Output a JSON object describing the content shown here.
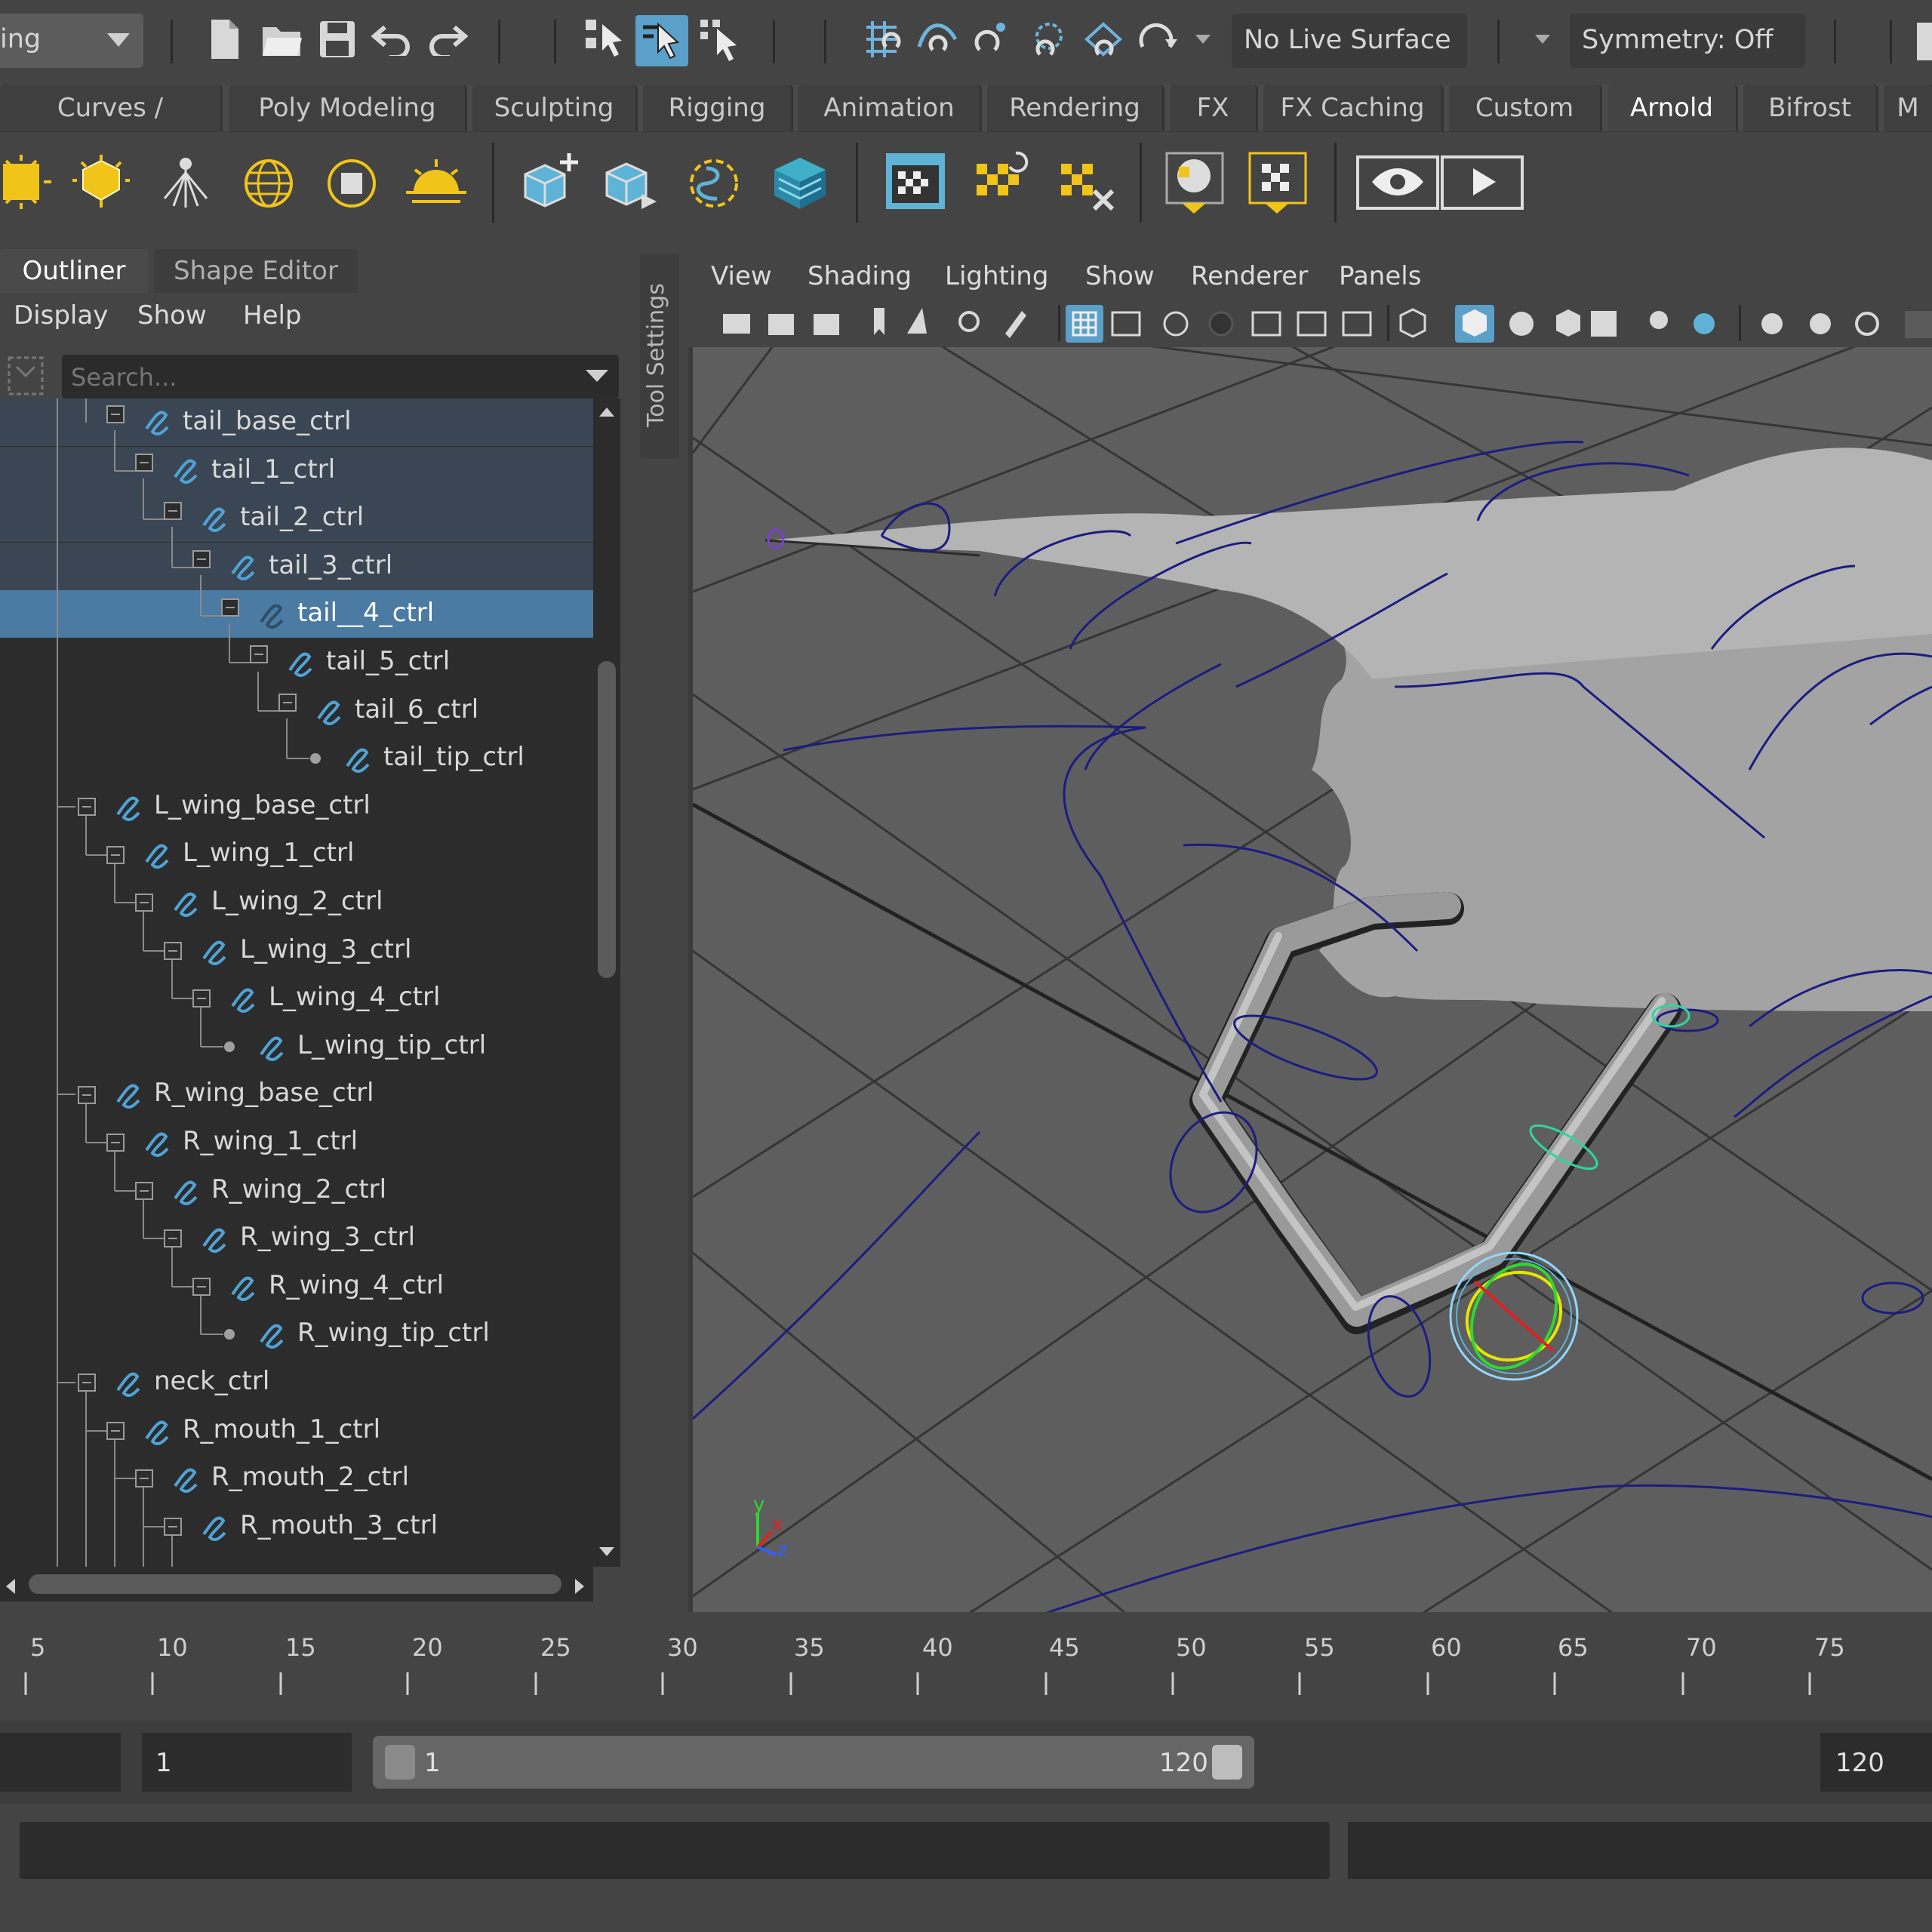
{
  "toolbar": {
    "menu_set": "ing",
    "live_surface": "No Live Surface",
    "symmetry": "Symmetry: Off"
  },
  "shelf_tabs": [
    "Curves / Surfaces",
    "Poly Modeling",
    "Sculpting",
    "Rigging",
    "Animation",
    "Rendering",
    "FX",
    "FX Caching",
    "Custom",
    "Arnold",
    "Bifrost",
    "M"
  ],
  "active_shelf_tab": "Arnold",
  "panel_tabs": {
    "outliner": "Outliner",
    "shape_editor": "Shape Editor"
  },
  "outliner_menu": [
    "Display",
    "Show",
    "Help"
  ],
  "search_placeholder": "Search...",
  "tool_settings": "Tool Settings",
  "tree": [
    "tail_base_ctrl",
    "tail_1_ctrl",
    "tail_2_ctrl",
    "tail_3_ctrl",
    "tail__4_ctrl",
    "tail_5_ctrl",
    "tail_6_ctrl",
    "tail_tip_ctrl",
    "L_wing_base_ctrl",
    "L_wing_1_ctrl",
    "L_wing_2_ctrl",
    "L_wing_3_ctrl",
    "L_wing_4_ctrl",
    "L_wing_tip_ctrl",
    "R_wing_base_ctrl",
    "R_wing_1_ctrl",
    "R_wing_2_ctrl",
    "R_wing_3_ctrl",
    "R_wing_4_ctrl",
    "R_wing_tip_ctrl",
    "neck_ctrl",
    "R_mouth_1_ctrl",
    "R_mouth_2_ctrl",
    "R_mouth_3_ctrl"
  ],
  "selected_item": "tail__4_ctrl",
  "viewport_menu": [
    "View",
    "Shading",
    "Lighting",
    "Show",
    "Renderer",
    "Panels"
  ],
  "axis_labels": {
    "y": "y",
    "x": "x",
    "z": "z"
  },
  "timeline_ticks": [
    "5",
    "10",
    "15",
    "20",
    "25",
    "30",
    "35",
    "40",
    "45",
    "50",
    "55",
    "60",
    "65",
    "70",
    "75"
  ],
  "range": {
    "start": "1",
    "slider_start": "1",
    "slider_end": "120",
    "end": "120"
  },
  "colors": {
    "selection": "#4b7aa2",
    "curve_icon": "#4fa3d6",
    "control_curve": "#1c1c80",
    "accent_green": "#2fd6a0"
  }
}
